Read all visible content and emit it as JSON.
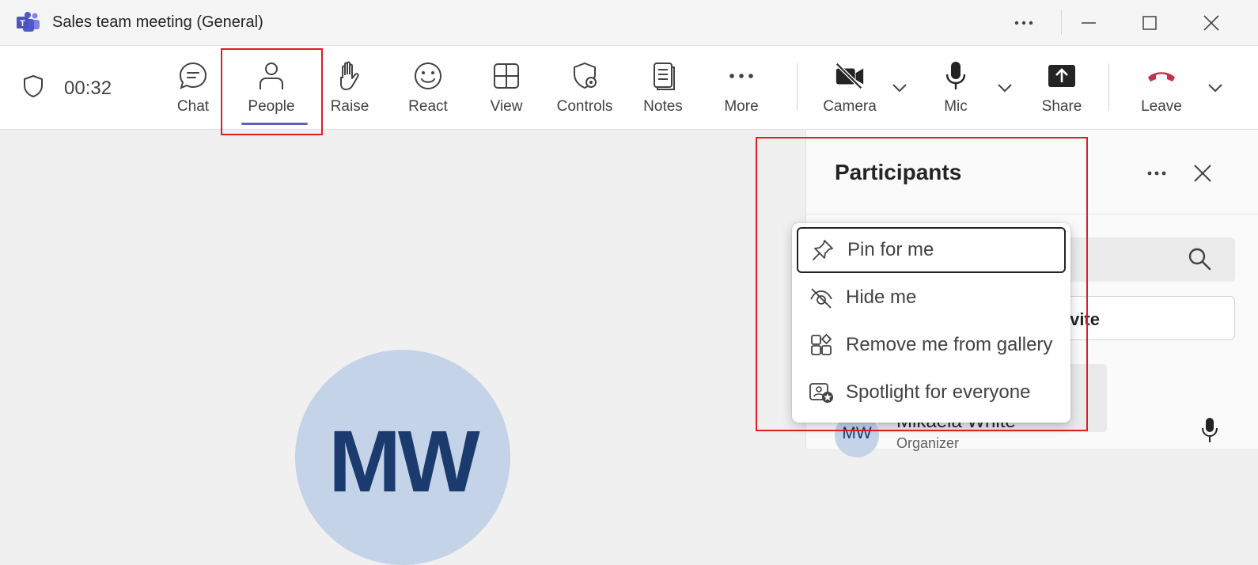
{
  "window": {
    "title": "Sales team meeting (General)",
    "logo_icon": "teams-logo-icon"
  },
  "meeting": {
    "timer": "00:32"
  },
  "toolbar": {
    "items": [
      {
        "label": "Chat",
        "icon": "chat-icon"
      },
      {
        "label": "People",
        "icon": "people-icon",
        "active": true
      },
      {
        "label": "Raise",
        "icon": "hand-icon"
      },
      {
        "label": "React",
        "icon": "smiley-icon"
      },
      {
        "label": "View",
        "icon": "grid-icon"
      },
      {
        "label": "Controls",
        "icon": "shield-gear-icon"
      },
      {
        "label": "Notes",
        "icon": "notes-icon"
      },
      {
        "label": "More",
        "icon": "more-icon"
      },
      {
        "label": "Camera",
        "icon": "camera-off-icon"
      },
      {
        "label": "Mic",
        "icon": "mic-icon"
      },
      {
        "label": "Share",
        "icon": "share-icon"
      },
      {
        "label": "Leave",
        "icon": "phone-hangup-icon"
      }
    ]
  },
  "stage": {
    "avatar_initials": "MW"
  },
  "panel": {
    "title": "Participants",
    "invite_label_visible": "vite",
    "participant": {
      "initials": "MW",
      "name": "Mikaela White",
      "role": "Organizer"
    }
  },
  "menu": {
    "items": [
      {
        "label": "Pin for me",
        "icon": "pin-icon"
      },
      {
        "label": "Hide me",
        "icon": "eye-off-icon"
      },
      {
        "label": "Remove me from gallery",
        "icon": "gallery-remove-icon"
      },
      {
        "label": "Spotlight for everyone",
        "icon": "spotlight-icon"
      }
    ]
  },
  "colors": {
    "accent": "#5b5fc7",
    "leave_red": "#c4314b",
    "highlight_box": "#e01e1e"
  }
}
